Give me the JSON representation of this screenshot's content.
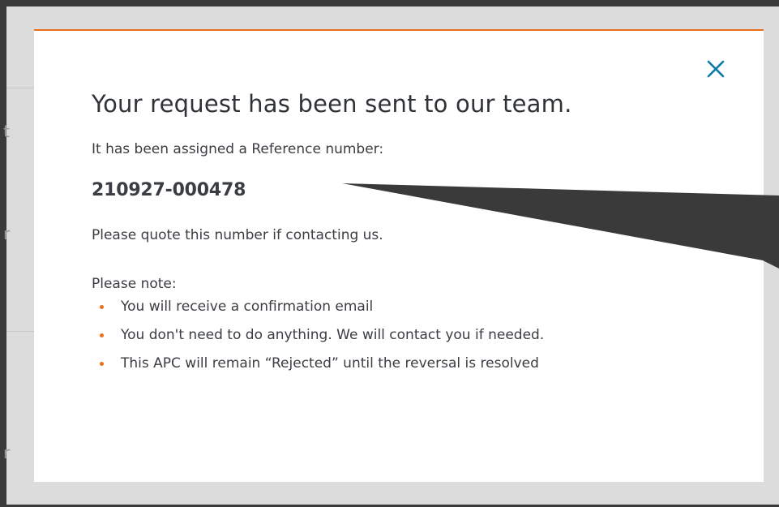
{
  "modal": {
    "title": "Your request has been sent to our team.",
    "assigned_text": "It has been assigned a Reference number:",
    "reference_number": "210927-000478",
    "quote_text": "Please quote this number if contacting us.",
    "note_heading": "Please note:",
    "notes": [
      "You will receive a confirmation email",
      "You don't need to do anything. We will contact you if needed.",
      "This APC will remain “Rejected” until the reversal is resolved"
    ],
    "close_icon": "close-icon"
  },
  "colors": {
    "accent": "#e9711c",
    "close": "#0c7aa6",
    "text": "#3a3d42",
    "callout": "#3a3a3a"
  }
}
